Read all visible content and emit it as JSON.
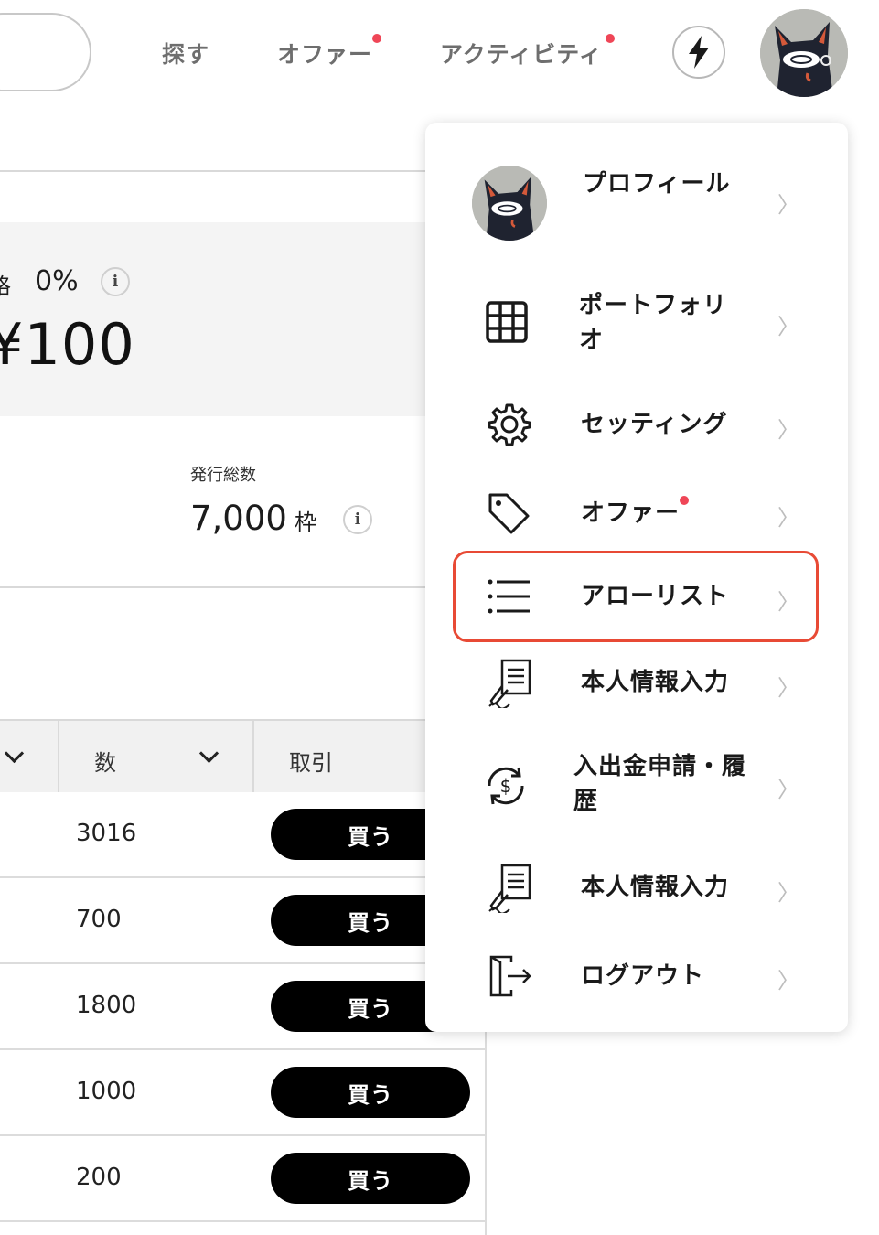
{
  "header": {
    "nav": [
      {
        "label": "探す",
        "dot": false
      },
      {
        "label": "オファー",
        "dot": true
      },
      {
        "label": "アクティビティ",
        "dot": true
      }
    ],
    "bolt_icon": "lightning-bolt-icon",
    "avatar_icon": "cat-avatar"
  },
  "summary": {
    "percent": "0%",
    "clipped_label": "格",
    "price": "¥100",
    "issued_label": "発行総数",
    "issued_value": "7,000",
    "issued_unit": "枠",
    "info_glyph": "i"
  },
  "table": {
    "headers": [
      "数",
      "取引"
    ],
    "rows": [
      {
        "qty": "3016",
        "action": "買う"
      },
      {
        "qty": "700",
        "action": "買う"
      },
      {
        "qty": "1800",
        "action": "買う"
      },
      {
        "qty": "1000",
        "action": "買う"
      },
      {
        "qty": "200",
        "action": "買う"
      }
    ]
  },
  "menu": {
    "chevron": "〉",
    "items": [
      {
        "label": "プロフィール",
        "icon": "avatar"
      },
      {
        "label": "ポートフォリ",
        "label2": "オ",
        "icon": "grid-icon"
      },
      {
        "label": "セッティング",
        "icon": "gear-icon"
      },
      {
        "label": "オファー",
        "icon": "tag-icon",
        "dot": true
      },
      {
        "label": "アローリスト",
        "icon": "list-icon",
        "highlighted": true
      },
      {
        "label": "本人情報入力",
        "icon": "document-sign-icon"
      },
      {
        "label": "入出金申請・履",
        "label2": "歴",
        "icon": "dollar-cycle-icon"
      },
      {
        "label": "本人情報入力",
        "icon": "document-sign-icon"
      },
      {
        "label": "ログアウト",
        "icon": "logout-icon"
      }
    ]
  },
  "colors": {
    "accent_red": "#ef4657",
    "highlight_border": "#e84a35",
    "button_black": "#000000"
  }
}
